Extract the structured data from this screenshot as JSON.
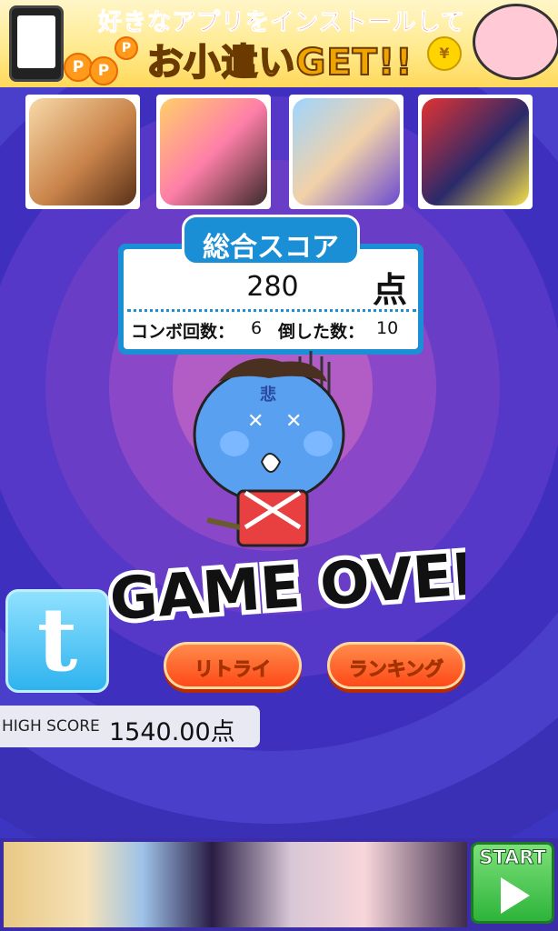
{
  "banner": {
    "line1": "好きなアプリをインストールして",
    "line2": "お小遣いGET!!",
    "coins": [
      "P",
      "P",
      "P"
    ],
    "yen": "¥"
  },
  "apps": [
    {
      "name": "app-1",
      "color1": "#f3c27a",
      "color2": "#6a3820"
    },
    {
      "name": "app-2",
      "color1": "#ff7fa8",
      "color2": "#f6d36a"
    },
    {
      "name": "app-3",
      "color1": "#6fb8ff",
      "color2": "#f2d2a8"
    },
    {
      "name": "app-4",
      "color1": "#2a2a6a",
      "color2": "#e23232"
    }
  ],
  "score_panel": {
    "title": "総合スコア",
    "score": "280",
    "unit": "点",
    "combo_label": "コンボ回数：",
    "combo_value": "6",
    "defeated_label": "倒した数：",
    "defeated_value": "10"
  },
  "character": {
    "face_text": "悲"
  },
  "game_over": {
    "text": "GAME OVER"
  },
  "buttons": {
    "twitter_glyph": "t",
    "retry": "リトライ",
    "ranking": "ランキング"
  },
  "high_score": {
    "label": "HIGH SCORE",
    "value": "1540.00点"
  },
  "ad": {
    "start": "START"
  },
  "colors": {
    "panel_blue": "#1a8fd6",
    "button_orange": "#ff5a20",
    "bg_purple": "#3a2fb8"
  }
}
